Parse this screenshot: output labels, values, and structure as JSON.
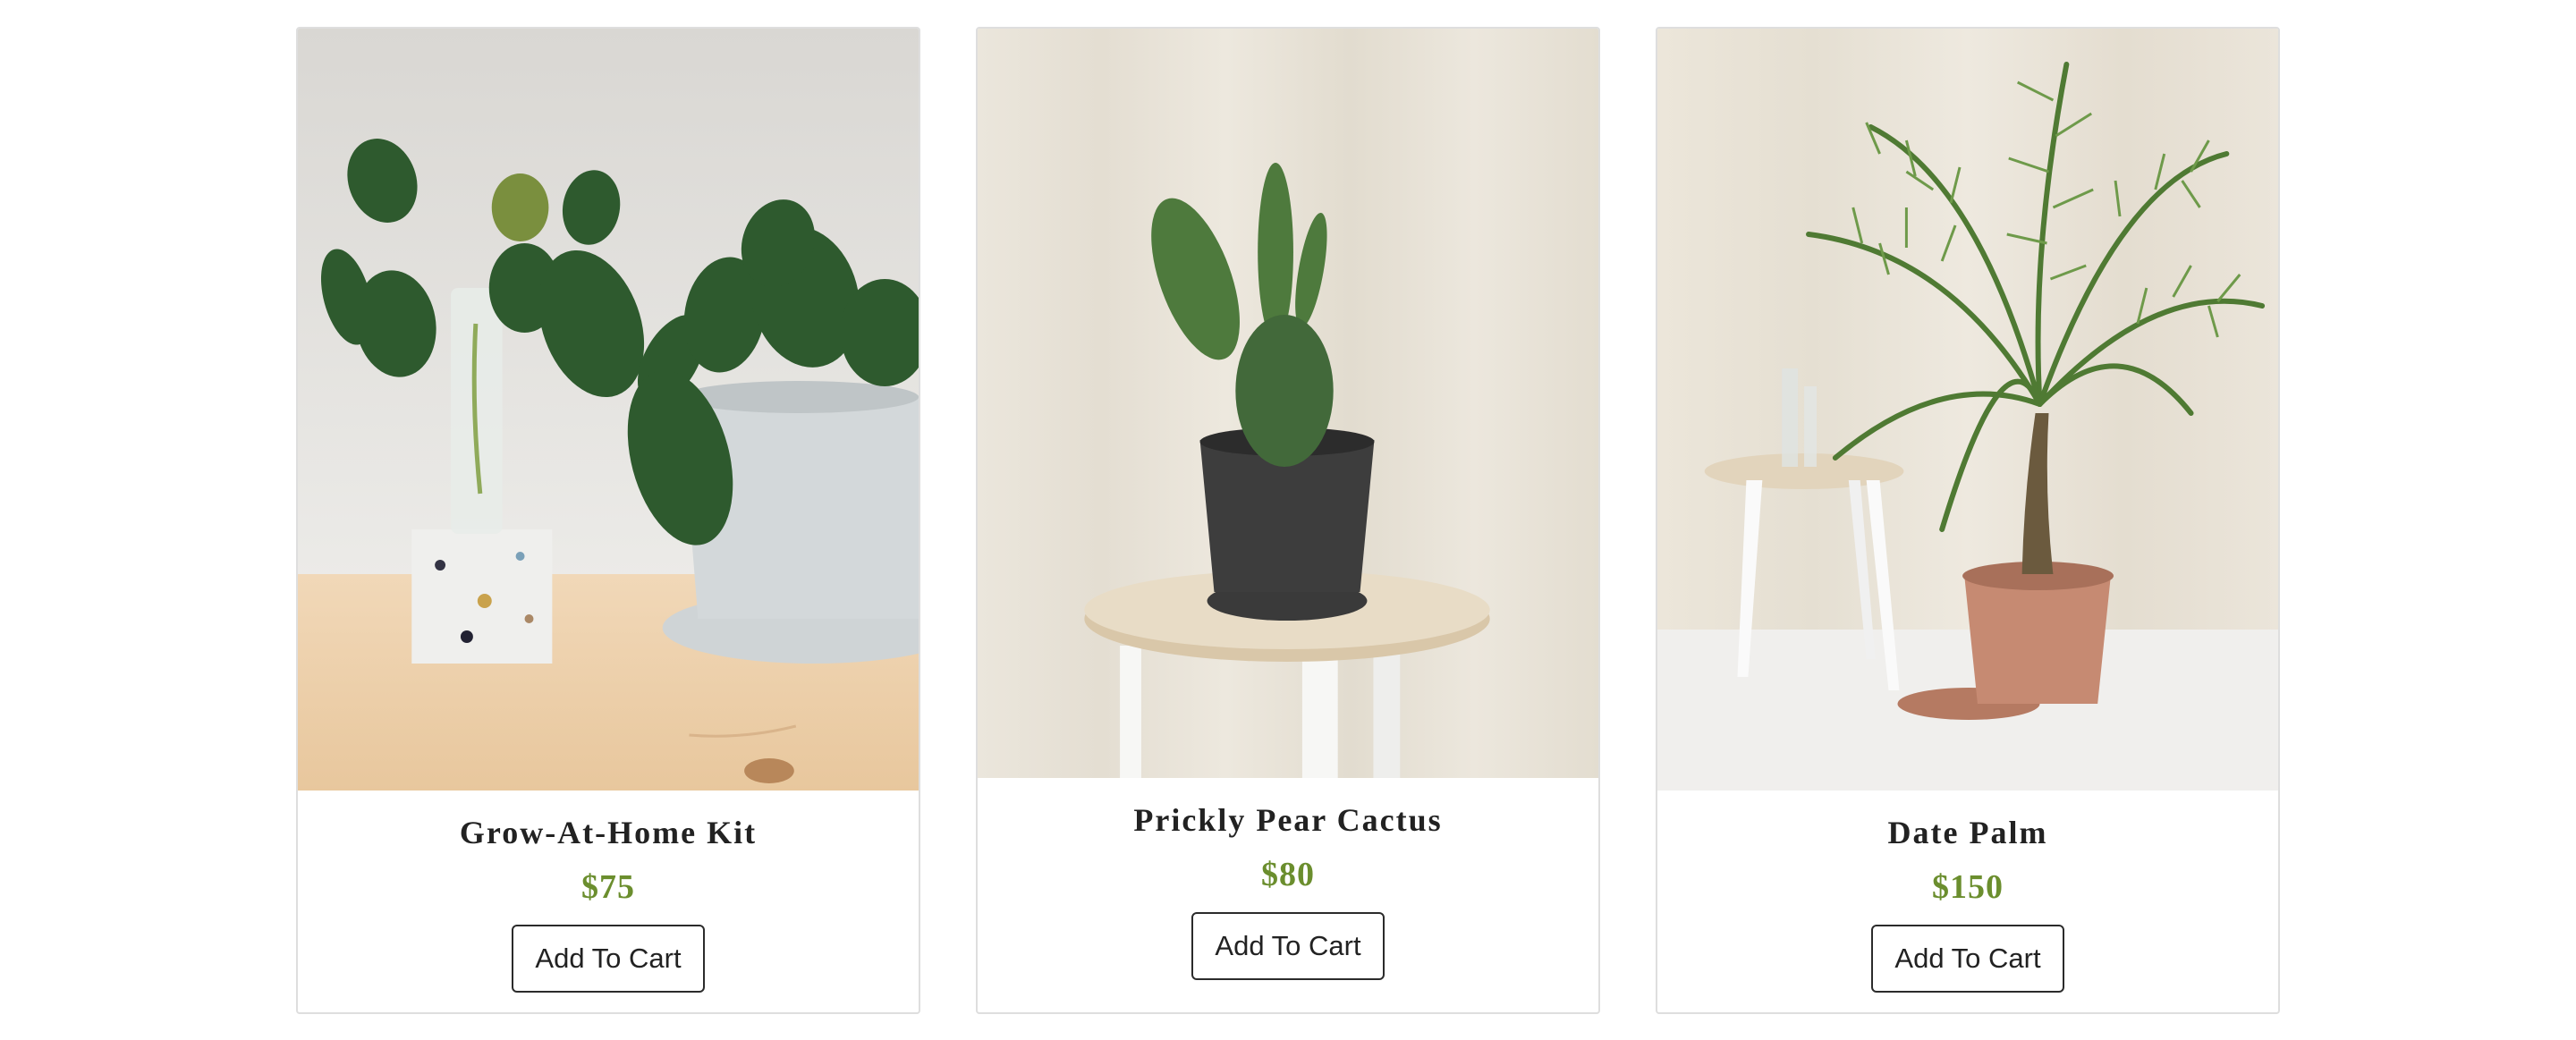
{
  "theme": {
    "price_color": "#6b8e2e",
    "card_border": "#dedede",
    "button_border": "#2b2b2b"
  },
  "products": [
    {
      "name": "Grow-At-Home Kit",
      "price": "$75",
      "button_label": "Add To Cart",
      "image_subject": "heartleaf philodendron in white planter beside terrazzo propagation vase on wood table"
    },
    {
      "name": "Prickly Pear Cactus",
      "price": "$80",
      "button_label": "Add To Cart",
      "image_subject": "prickly pear cactus in black pot on round wooden stool against cream curtain"
    },
    {
      "name": "Date Palm",
      "price": "$150",
      "button_label": "Add To Cart",
      "image_subject": "date palm in terracotta pot on white floor with side table against cream curtain"
    }
  ]
}
